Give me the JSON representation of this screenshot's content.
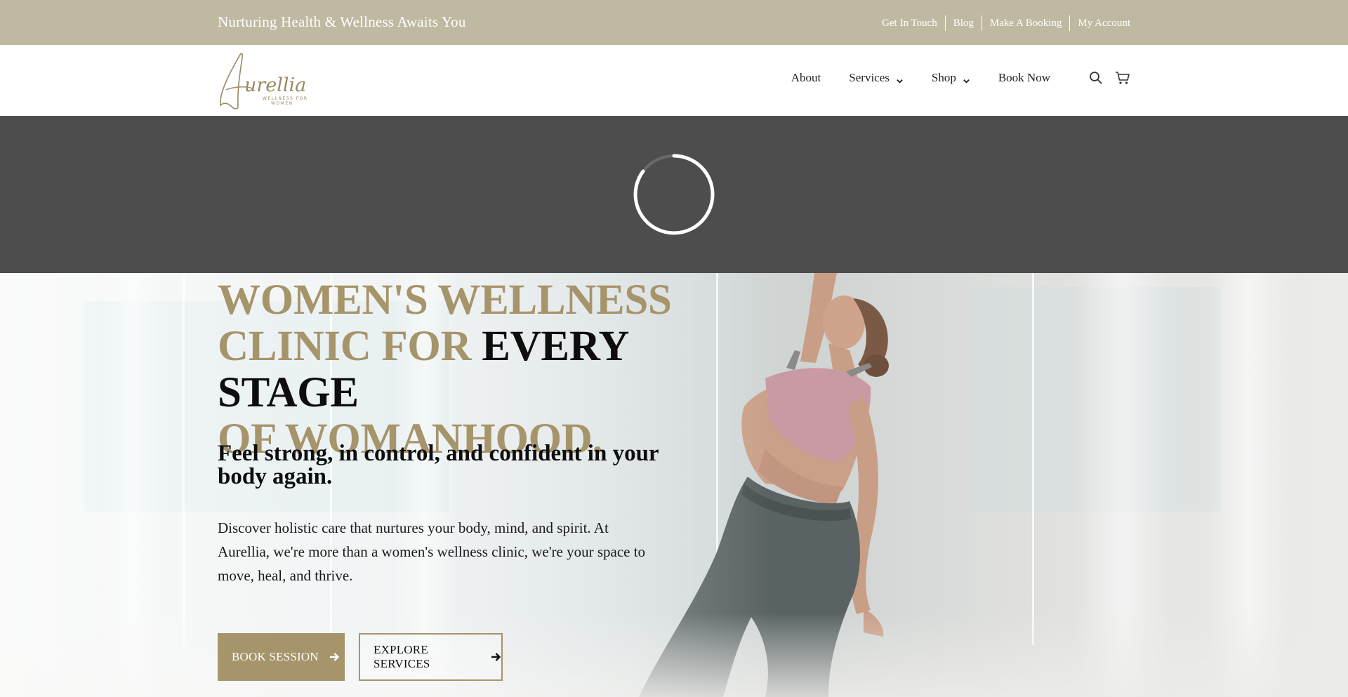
{
  "topbar": {
    "tagline": "Nurturing Health & Wellness Awaits You",
    "links": [
      "Get In Touch",
      "Blog",
      "Make A Booking",
      "My Account"
    ]
  },
  "header": {
    "logo": {
      "text": "Aurellia",
      "subtext": "WELLNESS FOR WOMEN"
    },
    "nav": {
      "about": "About",
      "services": "Services",
      "shop": "Shop",
      "book_now": "Book Now"
    },
    "icons": [
      "search-icon",
      "cart-icon"
    ]
  },
  "hero": {
    "headline_gold_1": "WOMEN'S WELLNESS",
    "headline_gold_2": "CLINIC FOR ",
    "headline_dark": "EVERY STAGE",
    "headline_gold_3": "OF WOMANHOOD.",
    "subheading": "Feel strong, in control, and confident in your body again.",
    "paragraph": "Discover holistic care that nurtures your body, mind, and spirit. At Aurellia, we're more than a women's wellness clinic, we're your space to move, heal, and thrive.",
    "book_button": "BOOK SESSION",
    "explore_button": "EXPLORE SERVICES"
  },
  "colors": {
    "topbar_bg": "#bfb9a2",
    "accent_gold": "#a6946a",
    "loader_bg": "#4d4d4d"
  }
}
